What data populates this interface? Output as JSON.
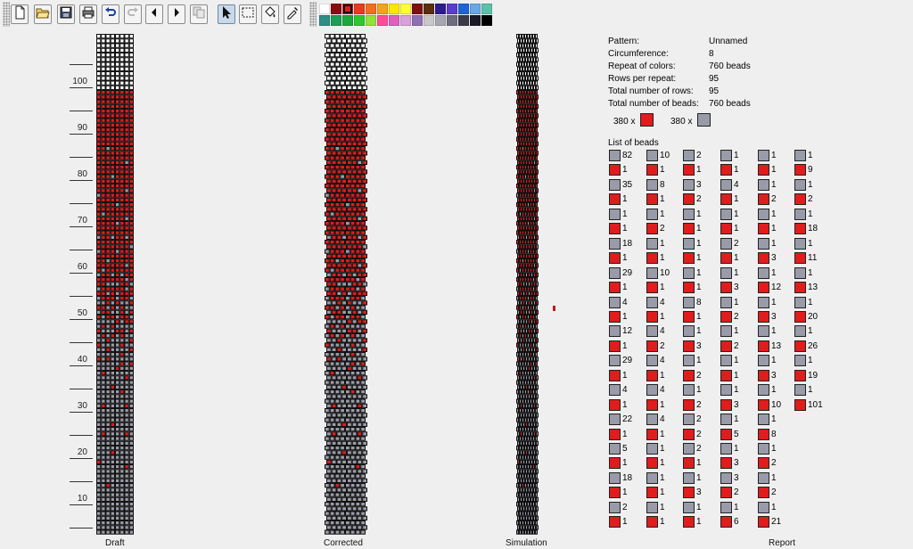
{
  "colors": {
    "bg": "#efefef",
    "white_bead": "#ffffff",
    "gray_bead": "#9a9ba8",
    "red_bead": "#e01c1c",
    "selected_swatch": "#8a0d0d"
  },
  "toolbar": {
    "buttons": [
      {
        "name": "new-file-button",
        "icon": "new-file-icon"
      },
      {
        "name": "open-button",
        "icon": "folder-open-icon"
      },
      {
        "name": "save-button",
        "icon": "floppy-disk-icon"
      },
      {
        "name": "print-button",
        "icon": "printer-icon"
      },
      {
        "name": "undo-button",
        "icon": "undo-icon"
      },
      {
        "name": "redo-button",
        "icon": "redo-icon"
      },
      {
        "name": "arrow-left-button",
        "icon": "arrow-left-icon"
      },
      {
        "name": "arrow-right-button",
        "icon": "arrow-right-icon"
      },
      {
        "name": "copy-button",
        "icon": "copy-icon"
      },
      {
        "name": "pointer-tool-button",
        "icon": "pointer-icon",
        "active": true
      },
      {
        "name": "select-tool-button",
        "icon": "marquee-select-icon"
      },
      {
        "name": "fill-tool-button",
        "icon": "paint-bucket-icon"
      },
      {
        "name": "eyedropper-tool-button",
        "icon": "eyedropper-icon"
      }
    ],
    "palette": [
      [
        "#ffffff",
        "#8a0d0d",
        "#e01c1c",
        "#e83a1e",
        "#f46f1b",
        "#f7a21b",
        "#ffe600",
        "#ffff33",
        "#7d1010",
        "#5a2e0e",
        "#2f1b8f",
        "#5a3bd0",
        "#1e63d8",
        "#6aa8e0",
        "#5cc1a8"
      ],
      [
        "#2c8f86",
        "#1d9e56",
        "#1aa83c",
        "#2fc62f",
        "#91e23a",
        "#ff4a9a",
        "#e060c0",
        "#d9a0d9",
        "#8e6fb3",
        "#c8c8c8",
        "#a6a6b3",
        "#6d6d80",
        "#3a3a4a",
        "#1a1a2a",
        "#000000"
      ]
    ],
    "selected_color": "#e01c1c"
  },
  "ruler": {
    "labels": [
      "100",
      "90",
      "80",
      "70",
      "60",
      "50",
      "40",
      "30",
      "20",
      "10"
    ]
  },
  "panes": {
    "draft_label": "Draft",
    "corrected_label": "Corrected",
    "simulation_label": "Simulation",
    "report_label": "Report"
  },
  "pattern": {
    "circumference": 8,
    "rows": 95,
    "total_rows_visible": 108
  },
  "report": {
    "info": [
      {
        "label": "Pattern:",
        "value": "Unnamed"
      },
      {
        "label": "Circumference:",
        "value": "8"
      },
      {
        "label": "Repeat of colors:",
        "value": "760 beads"
      },
      {
        "label": "Rows per repeat:",
        "value": "95"
      },
      {
        "label": "Total number of rows:",
        "value": "95"
      },
      {
        "label": "Total number of beads:",
        "value": "760 beads"
      }
    ],
    "color_counts": [
      {
        "text": "380 x",
        "color": "red"
      },
      {
        "text": "380 x",
        "color": "gray"
      }
    ],
    "list_title": "List of beads",
    "columns": [
      [
        [
          "gray",
          "82"
        ],
        [
          "red",
          "1"
        ],
        [
          "gray",
          "35"
        ],
        [
          "red",
          "1"
        ],
        [
          "gray",
          "1"
        ],
        [
          "red",
          "1"
        ],
        [
          "gray",
          "18"
        ],
        [
          "red",
          "1"
        ],
        [
          "gray",
          "29"
        ],
        [
          "red",
          "1"
        ],
        [
          "gray",
          "4"
        ],
        [
          "red",
          "1"
        ],
        [
          "gray",
          "12"
        ],
        [
          "red",
          "1"
        ],
        [
          "gray",
          "29"
        ],
        [
          "red",
          "1"
        ],
        [
          "gray",
          "4"
        ],
        [
          "red",
          "1"
        ],
        [
          "gray",
          "22"
        ],
        [
          "red",
          "1"
        ],
        [
          "gray",
          "5"
        ],
        [
          "red",
          "1"
        ],
        [
          "gray",
          "18"
        ],
        [
          "red",
          "1"
        ],
        [
          "gray",
          "2"
        ],
        [
          "red",
          "1"
        ]
      ],
      [
        [
          "gray",
          "10"
        ],
        [
          "red",
          "1"
        ],
        [
          "gray",
          "8"
        ],
        [
          "red",
          "1"
        ],
        [
          "gray",
          "1"
        ],
        [
          "red",
          "2"
        ],
        [
          "gray",
          "1"
        ],
        [
          "red",
          "1"
        ],
        [
          "gray",
          "10"
        ],
        [
          "red",
          "1"
        ],
        [
          "gray",
          "4"
        ],
        [
          "red",
          "1"
        ],
        [
          "gray",
          "4"
        ],
        [
          "red",
          "2"
        ],
        [
          "gray",
          "4"
        ],
        [
          "red",
          "1"
        ],
        [
          "gray",
          "4"
        ],
        [
          "red",
          "1"
        ],
        [
          "gray",
          "4"
        ],
        [
          "red",
          "1"
        ],
        [
          "gray",
          "1"
        ],
        [
          "red",
          "1"
        ],
        [
          "gray",
          "1"
        ],
        [
          "red",
          "1"
        ],
        [
          "gray",
          "1"
        ],
        [
          "red",
          "1"
        ]
      ],
      [
        [
          "gray",
          "2"
        ],
        [
          "red",
          "1"
        ],
        [
          "gray",
          "3"
        ],
        [
          "red",
          "2"
        ],
        [
          "gray",
          "1"
        ],
        [
          "red",
          "1"
        ],
        [
          "gray",
          "1"
        ],
        [
          "red",
          "1"
        ],
        [
          "gray",
          "1"
        ],
        [
          "red",
          "1"
        ],
        [
          "gray",
          "8"
        ],
        [
          "red",
          "1"
        ],
        [
          "gray",
          "1"
        ],
        [
          "red",
          "3"
        ],
        [
          "gray",
          "1"
        ],
        [
          "red",
          "2"
        ],
        [
          "gray",
          "1"
        ],
        [
          "red",
          "2"
        ],
        [
          "gray",
          "2"
        ],
        [
          "red",
          "2"
        ],
        [
          "gray",
          "2"
        ],
        [
          "red",
          "1"
        ],
        [
          "gray",
          "1"
        ],
        [
          "red",
          "3"
        ],
        [
          "gray",
          "1"
        ],
        [
          "red",
          "1"
        ]
      ],
      [
        [
          "gray",
          "1"
        ],
        [
          "red",
          "1"
        ],
        [
          "gray",
          "4"
        ],
        [
          "red",
          "1"
        ],
        [
          "gray",
          "1"
        ],
        [
          "red",
          "1"
        ],
        [
          "gray",
          "2"
        ],
        [
          "red",
          "1"
        ],
        [
          "gray",
          "1"
        ],
        [
          "red",
          "3"
        ],
        [
          "gray",
          "1"
        ],
        [
          "red",
          "2"
        ],
        [
          "gray",
          "1"
        ],
        [
          "red",
          "2"
        ],
        [
          "gray",
          "1"
        ],
        [
          "red",
          "1"
        ],
        [
          "gray",
          "1"
        ],
        [
          "red",
          "3"
        ],
        [
          "gray",
          "1"
        ],
        [
          "red",
          "5"
        ],
        [
          "gray",
          "1"
        ],
        [
          "red",
          "3"
        ],
        [
          "gray",
          "3"
        ],
        [
          "red",
          "2"
        ],
        [
          "gray",
          "1"
        ],
        [
          "red",
          "6"
        ]
      ],
      [
        [
          "gray",
          "1"
        ],
        [
          "red",
          "1"
        ],
        [
          "gray",
          "1"
        ],
        [
          "red",
          "2"
        ],
        [
          "gray",
          "1"
        ],
        [
          "red",
          "1"
        ],
        [
          "gray",
          "1"
        ],
        [
          "red",
          "3"
        ],
        [
          "gray",
          "1"
        ],
        [
          "red",
          "12"
        ],
        [
          "gray",
          "1"
        ],
        [
          "red",
          "3"
        ],
        [
          "gray",
          "1"
        ],
        [
          "red",
          "13"
        ],
        [
          "gray",
          "1"
        ],
        [
          "red",
          "3"
        ],
        [
          "gray",
          "1"
        ],
        [
          "red",
          "10"
        ],
        [
          "gray",
          "1"
        ],
        [
          "red",
          "8"
        ],
        [
          "gray",
          "1"
        ],
        [
          "red",
          "2"
        ],
        [
          "gray",
          "1"
        ],
        [
          "red",
          "2"
        ],
        [
          "gray",
          "1"
        ],
        [
          "red",
          "21"
        ]
      ],
      [
        [
          "gray",
          "1"
        ],
        [
          "red",
          "9"
        ],
        [
          "gray",
          "1"
        ],
        [
          "red",
          "2"
        ],
        [
          "gray",
          "1"
        ],
        [
          "red",
          "18"
        ],
        [
          "gray",
          "1"
        ],
        [
          "red",
          "11"
        ],
        [
          "gray",
          "1"
        ],
        [
          "red",
          "13"
        ],
        [
          "gray",
          "1"
        ],
        [
          "red",
          "20"
        ],
        [
          "gray",
          "1"
        ],
        [
          "red",
          "26"
        ],
        [
          "gray",
          "1"
        ],
        [
          "red",
          "19"
        ],
        [
          "gray",
          "1"
        ],
        [
          "red",
          "101"
        ]
      ]
    ]
  }
}
